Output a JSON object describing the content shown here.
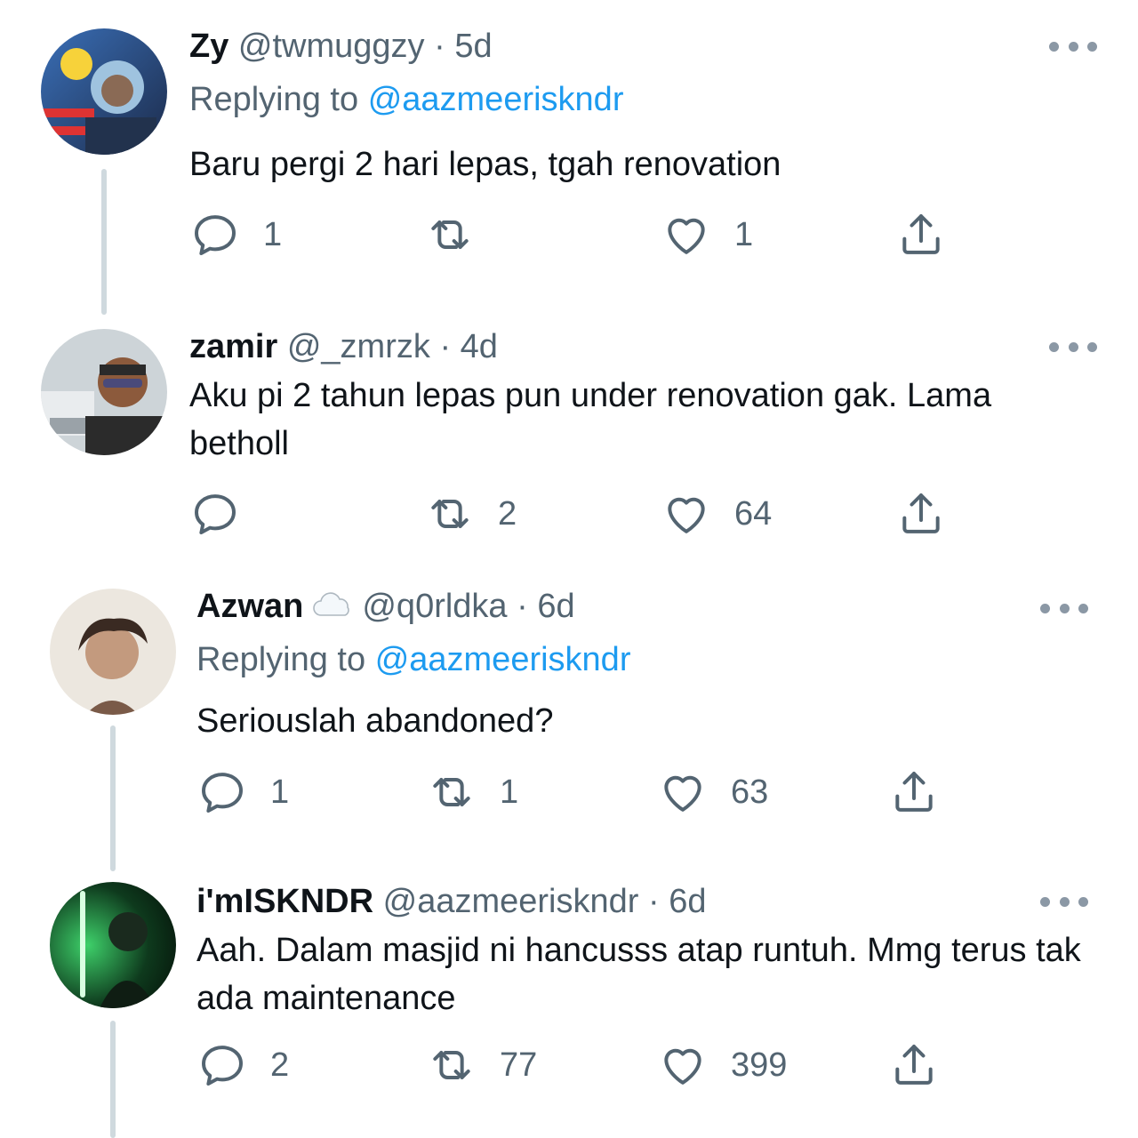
{
  "tweets": [
    {
      "name": "Zy",
      "handle": "@twmuggzy",
      "time": "5d",
      "replying_label": "Replying to",
      "replying_to": "@aazmeeriskndr",
      "text": "Baru pergi 2 hari lepas, tgah renovation",
      "replies": "1",
      "retweets": "",
      "likes": "1"
    },
    {
      "name": "zamir",
      "handle": "@_zmrzk",
      "time": "4d",
      "text": "Aku pi 2 tahun lepas pun under renovation gak. Lama betholl",
      "replies": "",
      "retweets": "2",
      "likes": "64"
    },
    {
      "name": "Azwan",
      "handle": "@q0rldka",
      "time": "6d",
      "replying_label": "Replying to",
      "replying_to": "@aazmeeriskndr",
      "text": "Seriouslah abandoned?",
      "replies": "1",
      "retweets": "1",
      "likes": "63"
    },
    {
      "name": "i'mISKNDR",
      "handle": "@aazmeeriskndr",
      "time": "6d",
      "text": "Aah. Dalam masjid ni hancusss atap runtuh. Mmg terus tak ada maintenance",
      "replies": "2",
      "retweets": "77",
      "likes": "399"
    }
  ],
  "separator": "·",
  "colors": {
    "accent": "#1d9bf0",
    "secondary_text": "#536471",
    "thread_line": "#cfd9de"
  },
  "icons": [
    "reply-icon",
    "retweet-icon",
    "like-icon",
    "share-icon",
    "more-icon",
    "cloud-emoji-icon"
  ]
}
